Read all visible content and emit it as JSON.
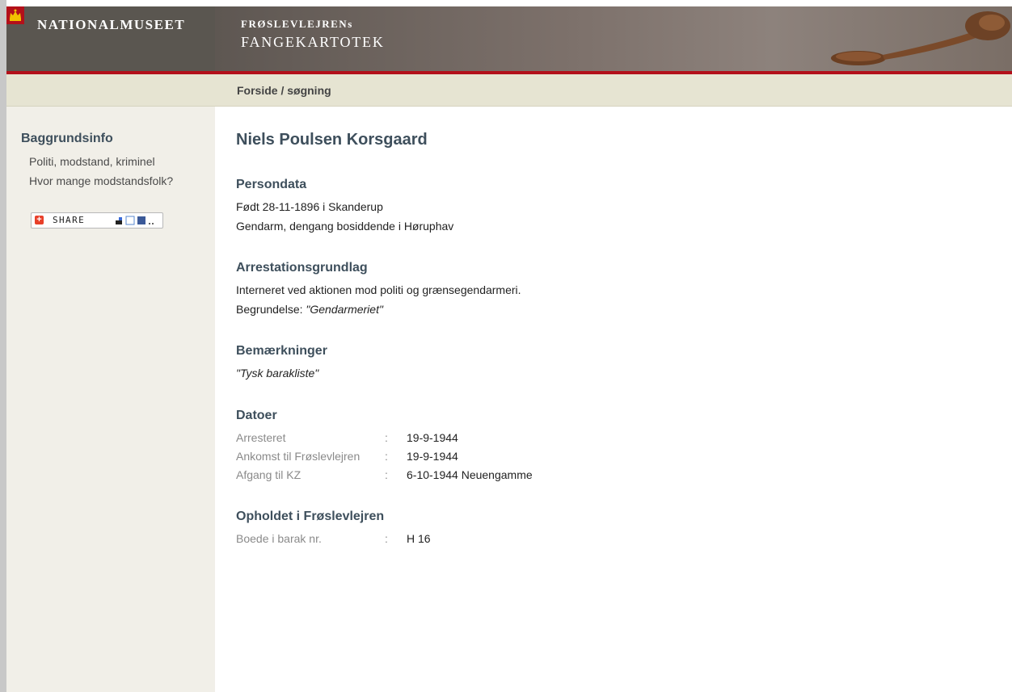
{
  "header": {
    "logo_text": "NATIONALMUSEET",
    "banner_line1": "FRØSLEVLEJRENs",
    "banner_line2": "FANGEKARTOTEK"
  },
  "breadcrumb": "Forside / søgning",
  "sidebar": {
    "title": "Baggrundsinfo",
    "links": [
      "Politi, modstand, kriminel",
      "Hvor mange modstandsfolk?"
    ],
    "share_label": "SHARE",
    "share_icon": "plus-icon"
  },
  "person": {
    "name": "Niels Poulsen Korsgaard",
    "persondata": {
      "title": "Persondata",
      "line1": "Født 28-11-1896 i Skanderup",
      "line2": "Gendarm, dengang bosiddende i Høruphav"
    },
    "arrest": {
      "title": "Arrestationsgrundlag",
      "line1": "Interneret ved aktionen mod politi og grænsegendarmeri.",
      "reason_label": "Begrundelse: ",
      "reason_value": "\"Gendarmeriet\""
    },
    "remarks": {
      "title": "Bemærkninger",
      "text": "\"Tysk barakliste\""
    },
    "dates": {
      "title": "Datoer",
      "rows": [
        {
          "label": "Arresteret",
          "colon": ":",
          "value": "19-9-1944"
        },
        {
          "label": "Ankomst til Frøslevlejren",
          "colon": ":",
          "value": "19-9-1944"
        },
        {
          "label": "Afgang til KZ",
          "colon": ":",
          "value": "6-10-1944 Neuengamme"
        }
      ]
    },
    "stay": {
      "title": "Opholdet i Frøslevlejren",
      "rows": [
        {
          "label": "Boede i barak nr.",
          "colon": ":",
          "value": "H 16"
        }
      ]
    }
  },
  "colors": {
    "accent_red": "#b3101a",
    "heading": "#3e4f5c",
    "breadcrumb_bg": "#e6e4d2",
    "sidebar_bg": "#f1efe8"
  }
}
